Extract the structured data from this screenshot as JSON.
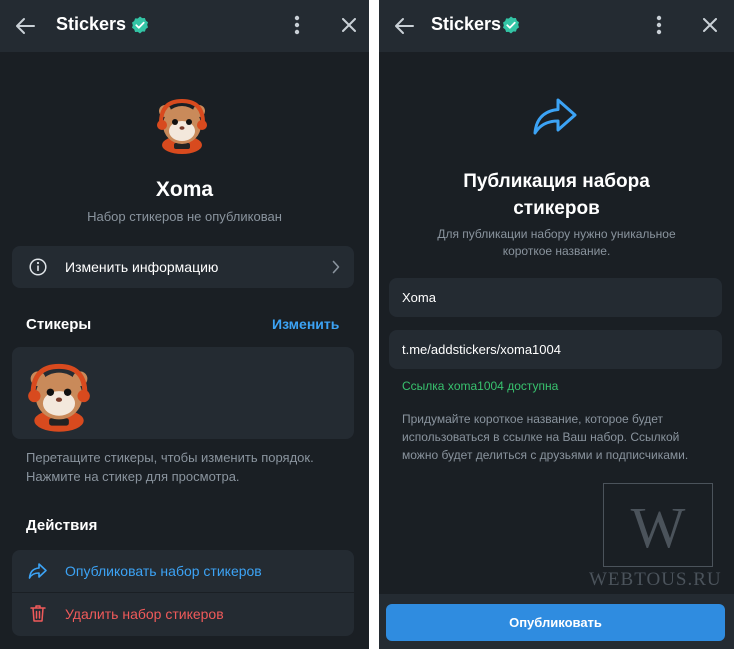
{
  "left": {
    "header": {
      "title": "Stickers"
    },
    "set": {
      "name": "Xoma",
      "status": "Набор стикеров не опубликован"
    },
    "edit_info": {
      "label": "Изменить информацию"
    },
    "stickers_section": {
      "heading": "Стикеры",
      "edit_label": "Изменить"
    },
    "hint": {
      "line1": "Перетащите стикеры, чтобы изменить порядок.",
      "line2": "Нажмите на стикер для просмотра."
    },
    "actions": {
      "heading": "Действия",
      "publish_label": "Опубликовать набор стикеров",
      "delete_label": "Удалить набор стикеров"
    }
  },
  "right": {
    "header": {
      "title": "Stickers"
    },
    "title_line1": "Публикация набора",
    "title_line2": "стикеров",
    "desc_line1": "Для публикации набору нужно уникальное",
    "desc_line2": "короткое название.",
    "name_input": {
      "value": "Xoma"
    },
    "link_input": {
      "value": "t.me/addstickers/xoma1004"
    },
    "availability": "Ссылка xoma1004 доступна",
    "help_line1": "Придумайте короткое название, которое будет",
    "help_line2": "использоваться в ссылке на Ваш набор. Ссылкой",
    "help_line3": "можно будет делиться с друзьями и подписчиками.",
    "publish_button": "Опубликовать"
  },
  "watermark": {
    "logo_letter": "W",
    "text": "WEBTOUS.RU"
  },
  "colors": {
    "background": "#1a1f24",
    "card": "#242b32",
    "accent": "#3ca3f5",
    "danger": "#f05a5a",
    "success": "#38c26e",
    "button": "#2f8ce0"
  }
}
